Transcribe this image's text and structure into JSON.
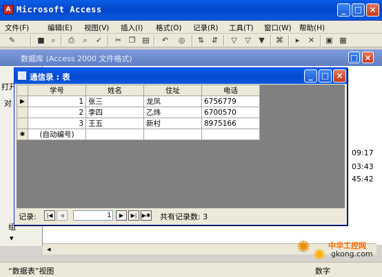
{
  "app": {
    "title": "Microsoft Access"
  },
  "menu": [
    "文件(F)",
    "编辑(E)",
    "视图(V)",
    "插入(I)",
    "格式(O)",
    "记录(R)",
    "工具(T)",
    "窗口(W)",
    "帮助(H)"
  ],
  "db_window": {
    "title_fragment": "数据库 (Access 2000 文件格式)",
    "left_items": [
      "打开",
      "对",
      "组"
    ],
    "times": [
      "09:17",
      "03:43",
      "45:42"
    ]
  },
  "datasheet": {
    "title": "通信录 : 表",
    "columns": [
      "学号",
      "姓名",
      "住址",
      "电话"
    ],
    "rows": [
      [
        "1",
        "张三",
        "龙凤",
        "6756779"
      ],
      [
        "2",
        "李四",
        "乙炜",
        "6700570"
      ],
      [
        "3",
        "王五",
        "新村",
        "8975166"
      ]
    ],
    "new_row": "(自动编号)",
    "nav": {
      "label": "记录:",
      "current": "1",
      "total_label": "共有记录数: 3"
    }
  },
  "status": {
    "left": "“数据表”视图",
    "right": "数字"
  },
  "watermark": {
    "brand": "中华工控网",
    "site": "gkong.com"
  }
}
